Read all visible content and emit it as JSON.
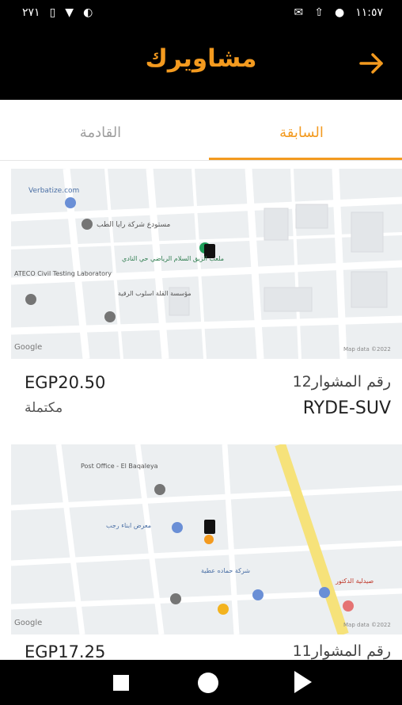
{
  "status_bar": {
    "left_text": "٢٧١",
    "time": "١١:٥٧"
  },
  "app_bar": {
    "title": "مشاويرك",
    "back_icon": "arrow-right-icon"
  },
  "tabs": {
    "past": "السابقة",
    "upcoming": "القادمة",
    "selected": "past"
  },
  "trips": [
    {
      "price": "EGP20.50",
      "status": "مكتملة",
      "ride_number": "رقم المشوار12",
      "car_model": "RYDE-SUV",
      "map_labels": {
        "poi1": "Verbatize.com",
        "poi2": "مستودع شركة رايا الطب",
        "poi3": "ملعب الزيق السلام الرياضي حي النادي",
        "poi4": "ATECO Civil Testing Laboratory",
        "poi5": "مؤسسة القلة اسلوب الرقية",
        "google": "Google",
        "map_data": "Map data ©2022"
      }
    },
    {
      "price": "EGP17.25",
      "status": "",
      "ride_number": "رقم المشوار11",
      "car_model": "",
      "map_labels": {
        "poi1": "Post Office - El Baqaleya",
        "poi2": "معرض ابناء رجب",
        "poi3": "شركة حماده عطية",
        "poi4": "صيدلية الدكتور",
        "google": "Google",
        "map_data": "Map data ©2022"
      }
    }
  ],
  "nav_bar": {
    "recents_icon": "square-icon",
    "home_icon": "circle-icon",
    "back_icon": "triangle-icon"
  },
  "colors": {
    "accent": "#f39a1f",
    "bar_background": "#000000"
  }
}
